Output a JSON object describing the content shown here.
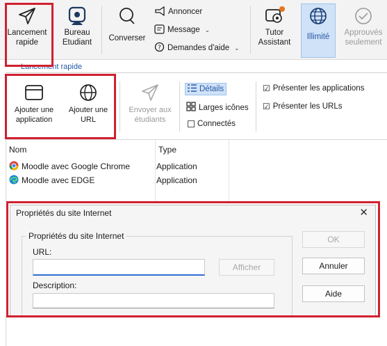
{
  "ribbon": {
    "lancement": {
      "label": "Lancement\nrapide",
      "chevron": "⌄",
      "icon": "paper-plane-icon"
    },
    "bureau": {
      "label": "Bureau\nEtudiant",
      "chevron": "⌄",
      "icon": "student-desktop-icon"
    },
    "converser": {
      "label": "Converser",
      "icon": "chat-bubble-icon"
    },
    "annoncer": {
      "label": "Annoncer",
      "icon": "megaphone-icon"
    },
    "message": {
      "label": "Message",
      "chevron": "⌄",
      "icon": "message-icon"
    },
    "demandes": {
      "label": "Demandes d'aide",
      "chevron": "⌄",
      "icon": "help-circle-icon"
    },
    "tutor": {
      "label": "Tutor\nAssistant",
      "chevron": "⌄",
      "icon": "tutor-gear-icon"
    },
    "illimite": {
      "label": "Illimité",
      "icon": "globe-icon"
    },
    "approuves": {
      "label": "Approuvés\nseulement",
      "chevron": "⌄",
      "icon": "check-circle-icon"
    }
  },
  "quick_launch": {
    "tab_label": "Lancement rapide",
    "add_application": "Ajouter une\napplication",
    "add_url": "Ajouter une\nURL",
    "send": "Envoyer aux\nétudiants",
    "details": "Détails",
    "large_icons": "Larges icônes",
    "connected": "Connectés",
    "show_apps": "Présenter les applications",
    "show_urls": "Présenter les URLs",
    "checked_mark": "☑",
    "unchecked_mark": ""
  },
  "list": {
    "columns": [
      "Nom",
      "Type"
    ],
    "rows": [
      {
        "name": "Moodle avec Google Chrome",
        "type": "Application",
        "icon": "chrome-icon"
      },
      {
        "name": "Moodle avec EDGE",
        "type": "Application",
        "icon": "edge-icon"
      }
    ]
  },
  "dialog": {
    "title": "Propriétés du site Internet",
    "close": "✕",
    "group_title": "Propriétés du site Internet",
    "url_label": "URL:",
    "url_value": "",
    "afficher": "Afficher",
    "description_label": "Description:",
    "description_value": "",
    "ok": "OK",
    "annuler": "Annuler",
    "aide": "Aide"
  },
  "colors": {
    "highlight": "#d0202f",
    "accent": "#2f6fd0",
    "active_bg": "#cfe2f7"
  }
}
